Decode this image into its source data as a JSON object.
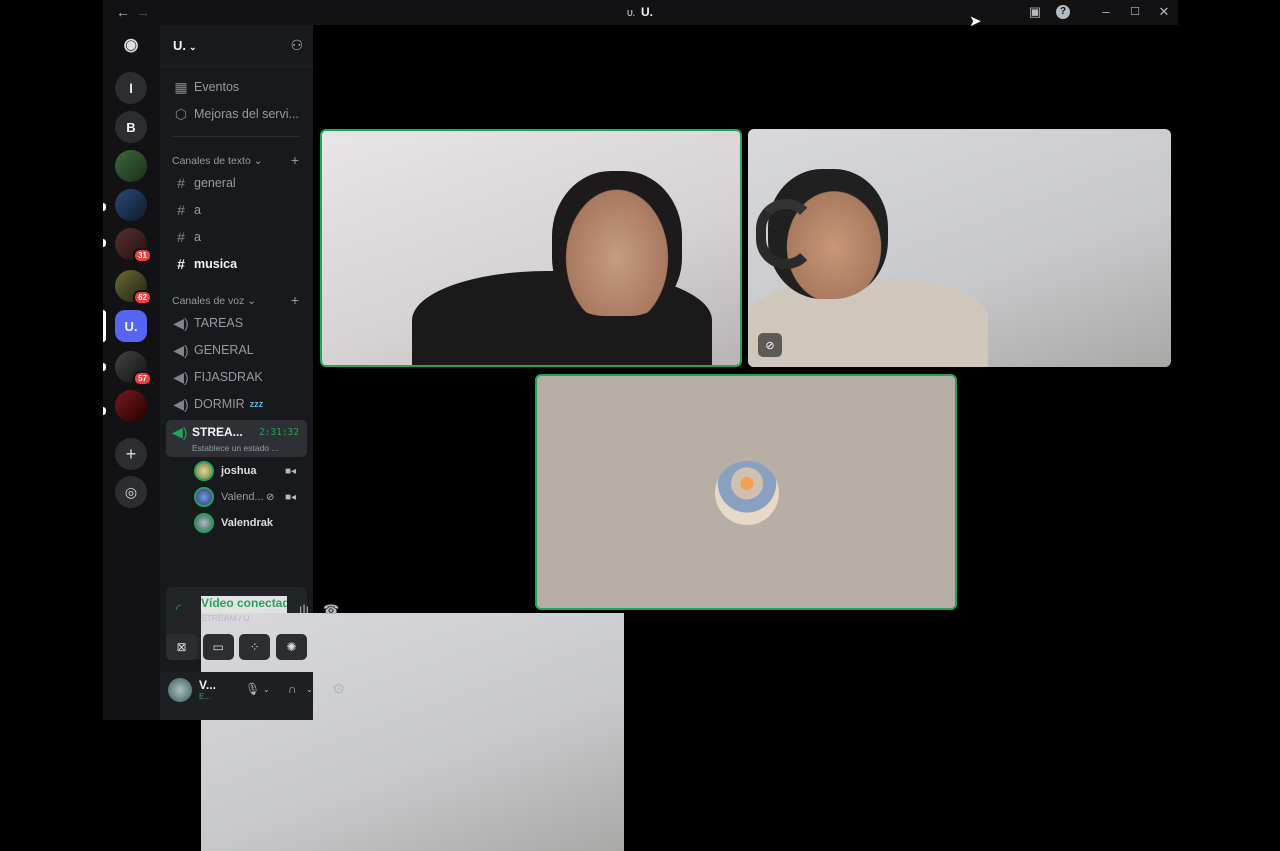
{
  "window": {
    "title": "U.",
    "title_prefix": "U.",
    "back_icon": "←",
    "forward_icon": "→"
  },
  "servers": [
    {
      "label": "l"
    },
    {
      "label": "B"
    },
    {
      "label": ""
    },
    {
      "label": ""
    },
    {
      "label": "",
      "badge": "31"
    },
    {
      "label": "",
      "badge": "62"
    },
    {
      "label": "U."
    },
    {
      "label": "",
      "badge": "57"
    },
    {
      "label": ""
    }
  ],
  "server": {
    "name": "U."
  },
  "nav": [
    {
      "label": "Eventos",
      "icon": "calendar-icon"
    },
    {
      "label": "Mejoras del servi...",
      "icon": "boost-icon"
    }
  ],
  "text_category": {
    "label": "Canales de texto"
  },
  "text_channels": [
    {
      "label": "general"
    },
    {
      "label": "a"
    },
    {
      "label": "a"
    },
    {
      "label": "musica"
    }
  ],
  "voice_category": {
    "label": "Canales de voz"
  },
  "voice_channels": [
    {
      "label": "TAREAS"
    },
    {
      "label": "GENERAL"
    },
    {
      "label": "FIJASDRAK"
    },
    {
      "label": "DORMIR",
      "extra": "zzz"
    }
  ],
  "active_voice": {
    "label": "STREA...",
    "timer": "2:31:32",
    "status": "Establece un estado ..."
  },
  "voice_users": [
    {
      "name": "joshua"
    },
    {
      "name": "Valend..."
    },
    {
      "name": "Valendrak"
    }
  ],
  "voice_panel": {
    "status": "Vídeo conectad",
    "channel": "STREAM / U."
  },
  "user": {
    "name": "V...",
    "sub": "E..."
  },
  "colors": {
    "accent": "#5865f2",
    "green": "#23a559",
    "bg": "#000000"
  }
}
